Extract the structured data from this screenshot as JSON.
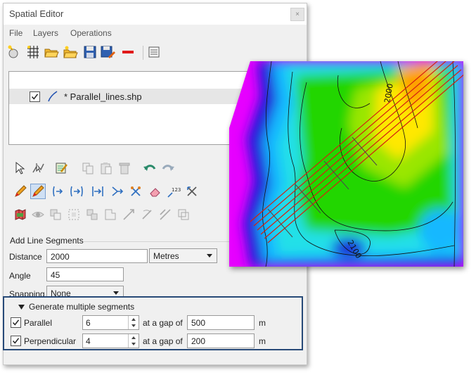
{
  "window": {
    "title": "Spatial Editor",
    "close_label": "×"
  },
  "menu": [
    {
      "label": "File"
    },
    {
      "label": "Layers"
    },
    {
      "label": "Operations"
    }
  ],
  "layers": [
    {
      "name": "* Parallel_lines.shp",
      "checked": true
    }
  ],
  "add_line_segments": {
    "section_title": "Add Line Segments",
    "distance_label": "Distance",
    "distance_value": "2000",
    "units_value": "Metres",
    "angle_label": "Angle",
    "angle_value": "45",
    "snapping_label": "Snapping",
    "snapping_value": "None"
  },
  "multiple_segments": {
    "title": "Generate multiple segments",
    "expanded": true,
    "parallel": {
      "label": "Parallel",
      "checked": true,
      "count": "6",
      "gap_label": "at a gap of",
      "gap": "500",
      "unit": "m"
    },
    "perpendicular": {
      "label": "Perpendicular",
      "checked": true,
      "count": "4",
      "gap_label": "at a gap of",
      "gap": "200",
      "unit": "m"
    }
  },
  "map": {
    "contour_labels": [
      "2000",
      "2100"
    ],
    "colors": {
      "high": "#ffe800",
      "mid": "#22d600",
      "low": "#1ee0ff",
      "deep": "#1d1dd6",
      "edge": "#e800ff",
      "lines": "#d42010"
    }
  },
  "colors": {
    "highlight_border": "#284a78",
    "window_bg": "#f0f0f0"
  }
}
